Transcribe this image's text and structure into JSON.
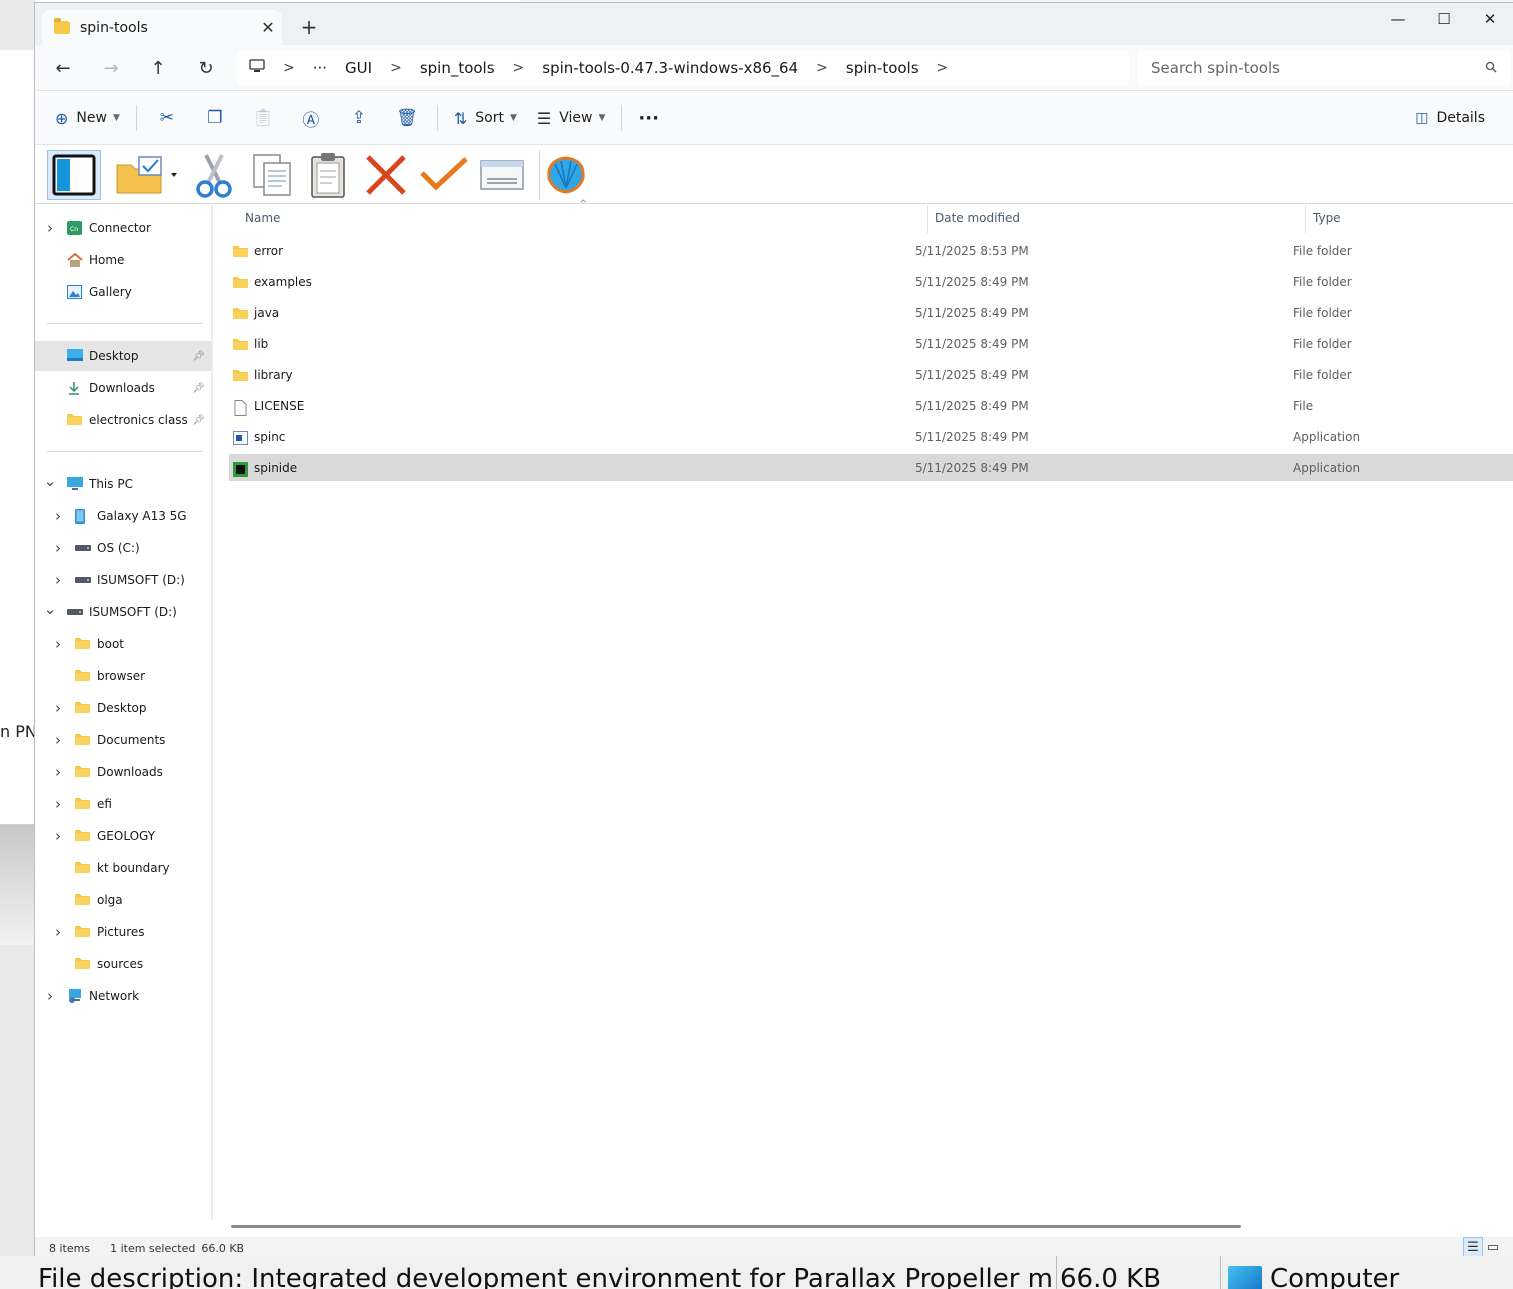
{
  "background": {
    "fragment_text": "n PN"
  },
  "window": {
    "tab_title": "spin-tools",
    "tab_close": "✕",
    "new_tab": "+",
    "controls": {
      "minimize": "—",
      "maximize": "☐",
      "close": "✕"
    }
  },
  "nav": {
    "back": "←",
    "forward": "→",
    "up": "↑",
    "refresh": "↻",
    "breadcrumb": [
      "GUI",
      "spin_tools",
      "spin-tools-0.47.3-windows-x86_64",
      "spin-tools"
    ],
    "ellipsis": "···",
    "search_placeholder": "Search spin-tools"
  },
  "commands": {
    "new_label": "New",
    "sort_label": "Sort",
    "view_label": "View",
    "more": "···",
    "details_label": "Details"
  },
  "sidebar": {
    "quick": [
      {
        "label": "Connector",
        "icon": "connector-icon",
        "expandable": true
      },
      {
        "label": "Home",
        "icon": "home-icon",
        "expandable": false
      },
      {
        "label": "Gallery",
        "icon": "gallery-icon",
        "expandable": false
      }
    ],
    "pinned": [
      {
        "label": "Desktop",
        "icon": "desktop-icon",
        "pinned": true,
        "selected": true
      },
      {
        "label": "Downloads",
        "icon": "download-icon",
        "pinned": true
      },
      {
        "label": "electronics class",
        "icon": "folder-icon",
        "pinned": true
      }
    ],
    "tree": [
      {
        "label": "This PC",
        "icon": "computer-icon",
        "level": 0,
        "state": "expanded"
      },
      {
        "label": "Galaxy A13 5G",
        "icon": "phone-icon",
        "level": 1,
        "state": "collapsed"
      },
      {
        "label": "OS (C:)",
        "icon": "drive-icon",
        "level": 1,
        "state": "collapsed"
      },
      {
        "label": "ISUMSOFT (D:)",
        "icon": "drive-icon",
        "level": 1,
        "state": "collapsed"
      },
      {
        "label": "ISUMSOFT (D:)",
        "icon": "drive-icon",
        "level": 0,
        "state": "expanded"
      },
      {
        "label": "boot",
        "icon": "folder-icon",
        "level": 1,
        "state": "collapsed"
      },
      {
        "label": "browser",
        "icon": "folder-icon",
        "level": 1,
        "state": "none"
      },
      {
        "label": "Desktop",
        "icon": "folder-icon",
        "level": 1,
        "state": "collapsed"
      },
      {
        "label": "Documents",
        "icon": "folder-icon",
        "level": 1,
        "state": "collapsed"
      },
      {
        "label": "Downloads",
        "icon": "folder-icon",
        "level": 1,
        "state": "collapsed"
      },
      {
        "label": "efi",
        "icon": "folder-icon",
        "level": 1,
        "state": "collapsed"
      },
      {
        "label": "GEOLOGY",
        "icon": "folder-icon",
        "level": 1,
        "state": "collapsed"
      },
      {
        "label": "kt boundary",
        "icon": "folder-icon",
        "level": 1,
        "state": "none"
      },
      {
        "label": "olga",
        "icon": "folder-icon",
        "level": 1,
        "state": "none"
      },
      {
        "label": "Pictures",
        "icon": "folder-icon",
        "level": 1,
        "state": "collapsed"
      },
      {
        "label": "sources",
        "icon": "folder-icon",
        "level": 1,
        "state": "none"
      },
      {
        "label": "Network",
        "icon": "network-icon",
        "level": 0,
        "state": "collapsed"
      }
    ]
  },
  "columns": {
    "name": "Name",
    "date": "Date modified",
    "type": "Type"
  },
  "files": [
    {
      "name": "error",
      "date": "5/11/2025 8:53 PM",
      "type": "File folder",
      "icon": "folder-icon"
    },
    {
      "name": "examples",
      "date": "5/11/2025 8:49 PM",
      "type": "File folder",
      "icon": "folder-icon"
    },
    {
      "name": "java",
      "date": "5/11/2025 8:49 PM",
      "type": "File folder",
      "icon": "folder-icon"
    },
    {
      "name": "lib",
      "date": "5/11/2025 8:49 PM",
      "type": "File folder",
      "icon": "folder-icon"
    },
    {
      "name": "library",
      "date": "5/11/2025 8:49 PM",
      "type": "File folder",
      "icon": "folder-icon"
    },
    {
      "name": "LICENSE",
      "date": "5/11/2025 8:49 PM",
      "type": "File",
      "icon": "file-icon"
    },
    {
      "name": "spinc",
      "date": "5/11/2025 8:49 PM",
      "type": "Application",
      "icon": "app-icon"
    },
    {
      "name": "spinide",
      "date": "5/11/2025 8:49 PM",
      "type": "Application",
      "icon": "chip-icon",
      "selected": true
    }
  ],
  "status": {
    "count": "8 items",
    "selection": "1 item selected",
    "size": "66.0 KB"
  },
  "tooltip": {
    "description": "File description: Integrated development environment for Parallax Propeller m",
    "size": "66.0 KB",
    "location": "Computer"
  },
  "colors": {
    "accent": "#1f5aa6",
    "selected_row": "#d9d9d9",
    "folder": "#f7c948"
  }
}
